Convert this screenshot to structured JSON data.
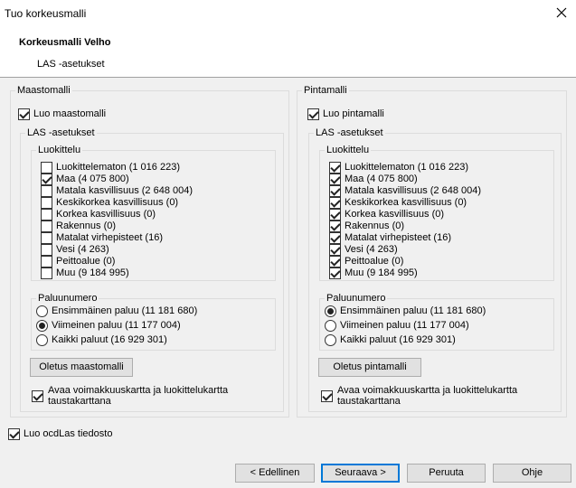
{
  "window": {
    "title": "Tuo korkeusmalli"
  },
  "header": {
    "title": "Korkeusmalli Velho",
    "subtitle": "LAS -asetukset"
  },
  "left": {
    "group_label": "Maastomalli",
    "create_label": "Luo maastomalli",
    "create_checked": true,
    "las_label": "LAS -asetukset",
    "class_label": "Luokittelu",
    "classes": [
      {
        "label": "Luokittelematon  (1 016 223)",
        "checked": false
      },
      {
        "label": "Maa (4 075 800)",
        "checked": true
      },
      {
        "label": "Matala kasvillisuus (2 648 004)",
        "checked": false
      },
      {
        "label": "Keskikorkea kasvillisuus (0)",
        "checked": false
      },
      {
        "label": "Korkea kasvillisuus (0)",
        "checked": false
      },
      {
        "label": "Rakennus (0)",
        "checked": false
      },
      {
        "label": "Matalat virhepisteet (16)",
        "checked": false
      },
      {
        "label": "Vesi (4 263)",
        "checked": false
      },
      {
        "label": "Peittoalue (0)",
        "checked": false
      },
      {
        "label": "Muu (9 184 995)",
        "checked": false
      }
    ],
    "return_label": "Paluunumero",
    "returns": [
      {
        "label": "Ensimmäinen paluu (11 181 680)",
        "selected": false
      },
      {
        "label": "Viimeinen paluu (11 177 004)",
        "selected": true
      },
      {
        "label": "Kaikki paluut (16 929 301)",
        "selected": false
      }
    ],
    "default_button": "Oletus maastomalli",
    "open_label": "Avaa voimakkuuskartta ja luokittelukartta taustakarttana",
    "open_checked": true
  },
  "right": {
    "group_label": "Pintamalli",
    "create_label": "Luo pintamalli",
    "create_checked": true,
    "las_label": "LAS -asetukset",
    "class_label": "Luokittelu",
    "classes": [
      {
        "label": "Luokittelematon  (1 016 223)",
        "checked": true
      },
      {
        "label": "Maa (4 075 800)",
        "checked": true
      },
      {
        "label": "Matala kasvillisuus (2 648 004)",
        "checked": true
      },
      {
        "label": "Keskikorkea kasvillisuus (0)",
        "checked": true
      },
      {
        "label": "Korkea kasvillisuus (0)",
        "checked": true
      },
      {
        "label": "Rakennus (0)",
        "checked": true
      },
      {
        "label": "Matalat virhepisteet (16)",
        "checked": true
      },
      {
        "label": "Vesi (4 263)",
        "checked": true
      },
      {
        "label": "Peittoalue (0)",
        "checked": true
      },
      {
        "label": "Muu (9 184 995)",
        "checked": true
      }
    ],
    "return_label": "Paluunumero",
    "returns": [
      {
        "label": "Ensimmäinen paluu (11 181 680)",
        "selected": true
      },
      {
        "label": "Viimeinen paluu (11 177 004)",
        "selected": false
      },
      {
        "label": "Kaikki paluut (16 929 301)",
        "selected": false
      }
    ],
    "default_button": "Oletus pintamalli",
    "open_label": "Avaa voimakkuuskartta ja luokittelukartta taustakarttana",
    "open_checked": true
  },
  "ocd": {
    "label": "Luo ocdLas tiedosto",
    "checked": true
  },
  "footer": {
    "back": "< Edellinen",
    "next": "Seuraava >",
    "cancel": "Peruuta",
    "help": "Ohje"
  }
}
